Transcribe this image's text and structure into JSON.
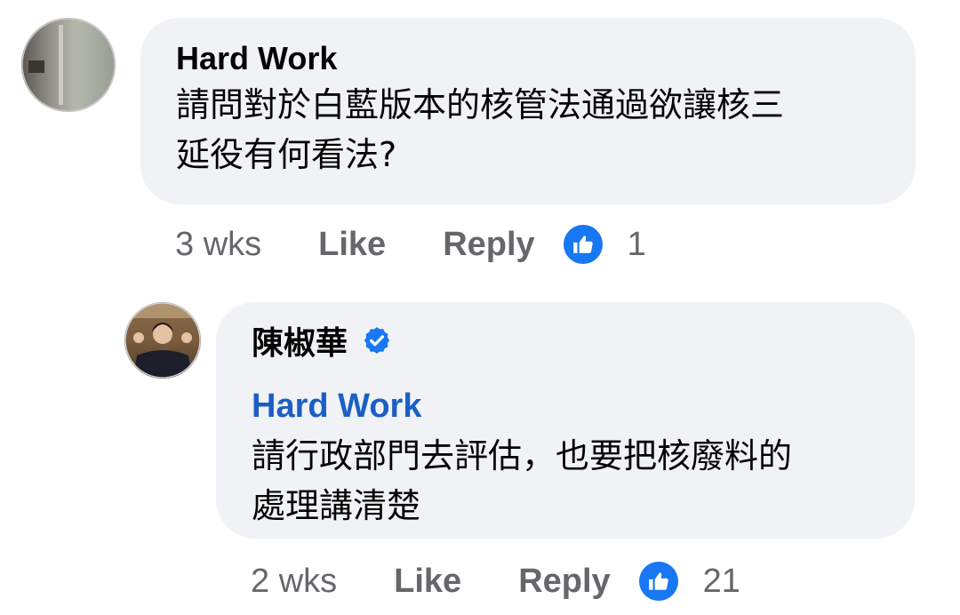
{
  "comment": {
    "author": "Hard Work",
    "text": "請問對於白藍版本的核管法通過欲讓核三\n延役有何看法?",
    "time": "3 wks",
    "like_label": "Like",
    "reply_label": "Reply",
    "reaction_count": "1",
    "reaction_icon": "thumbs-up-icon"
  },
  "reply": {
    "author": "陳椒華",
    "verified_icon": "verified-badge-icon",
    "mention": "Hard Work",
    "text": "請行政部門去評估，也要把核廢料的\n處理講清楚",
    "time": "2 wks",
    "like_label": "Like",
    "reply_label": "Reply",
    "reaction_count": "21",
    "reaction_icon": "thumbs-up-icon"
  },
  "colors": {
    "bubble_bg": "#f0f2f5",
    "meta_text": "#65676b",
    "link_blue": "#1b5fc4",
    "like_blue": "#1877f2",
    "verified_blue": "#1877f2"
  }
}
